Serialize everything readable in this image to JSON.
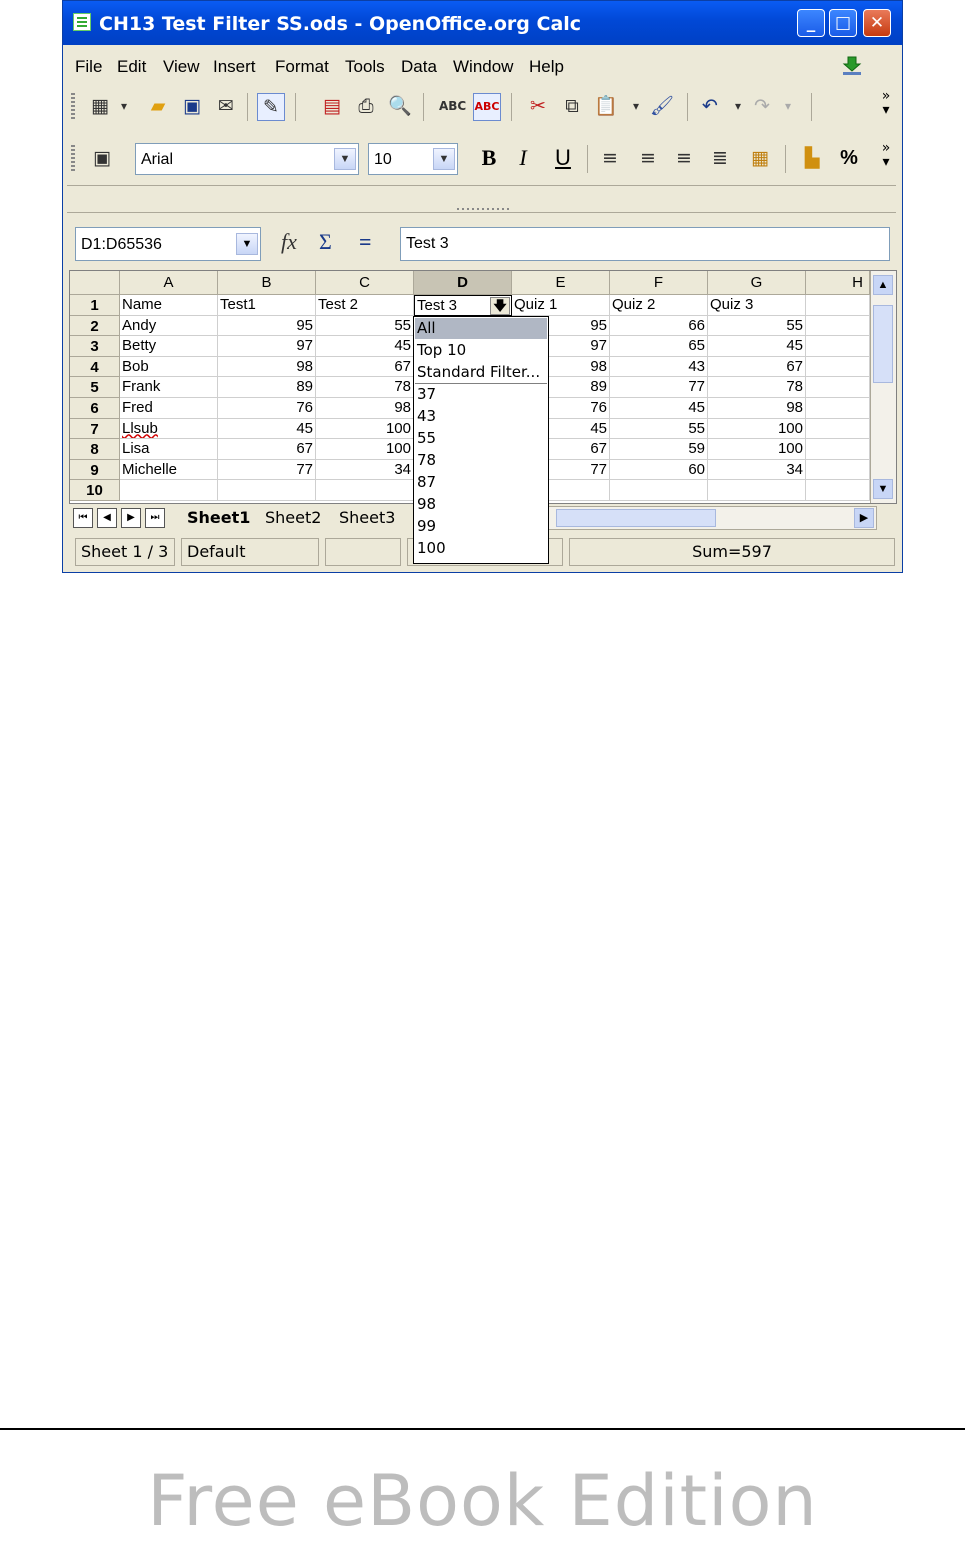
{
  "window": {
    "title": "CH13 Test Filter SS.ods - OpenOffice.org Calc",
    "controls": [
      "_",
      "□",
      "✕"
    ]
  },
  "menu": [
    {
      "label": "File"
    },
    {
      "label": "Edit"
    },
    {
      "label": "View"
    },
    {
      "label": "Insert"
    },
    {
      "label": "Format"
    },
    {
      "label": "Tools"
    },
    {
      "label": "Data"
    },
    {
      "label": "Window"
    },
    {
      "label": "Help"
    }
  ],
  "toolbar_format": {
    "font_name": "Arial",
    "font_size": "10",
    "bold": "B",
    "italic": "I",
    "underline": "U",
    "percent": "%"
  },
  "formula_bar": {
    "name_box": "D1:D65536",
    "equals": "=",
    "sigma": "Σ",
    "fx": "fx",
    "content": "Test 3"
  },
  "grid": {
    "columns": [
      "A",
      "B",
      "C",
      "D",
      "E",
      "F",
      "G",
      "H"
    ],
    "selected_column": "D",
    "row_numbers": [
      "1",
      "2",
      "3",
      "4",
      "5",
      "6",
      "7",
      "8",
      "9",
      "10"
    ],
    "rows": [
      [
        "Name",
        "Test1",
        "Test 2",
        "Test 3",
        "Quiz 1",
        "Quiz 2",
        "Quiz 3",
        ""
      ],
      [
        "Andy",
        "95",
        "55",
        "",
        "95",
        "66",
        "55",
        ""
      ],
      [
        "Betty",
        "97",
        "45",
        "",
        "97",
        "65",
        "45",
        ""
      ],
      [
        "Bob",
        "98",
        "67",
        "",
        "98",
        "43",
        "67",
        ""
      ],
      [
        "Frank",
        "89",
        "78",
        "",
        "89",
        "77",
        "78",
        ""
      ],
      [
        "Fred",
        "76",
        "98",
        "",
        "76",
        "45",
        "98",
        ""
      ],
      [
        "Llsub",
        "45",
        "100",
        "",
        "45",
        "55",
        "100",
        ""
      ],
      [
        "Lisa",
        "67",
        "100",
        "",
        "67",
        "59",
        "100",
        ""
      ],
      [
        "Michelle",
        "77",
        "34",
        "",
        "77",
        "60",
        "34",
        ""
      ],
      [
        "",
        "",
        "",
        "",
        "",
        "",
        "",
        ""
      ]
    ]
  },
  "filter_dropdown": {
    "options": [
      "All",
      "Top 10",
      "Standard Filter...",
      "37",
      "43",
      "55",
      "78",
      "87",
      "98",
      "99",
      "100"
    ],
    "highlighted": "All"
  },
  "sheet_tabs": [
    "Sheet1",
    "Sheet2",
    "Sheet3"
  ],
  "active_sheet": "Sheet1",
  "status_bar": {
    "sheet": "Sheet 1 / 3",
    "page_style": "Default",
    "sum": "Sum=597"
  },
  "footer": {
    "watermark": "Free eBook Edition"
  }
}
